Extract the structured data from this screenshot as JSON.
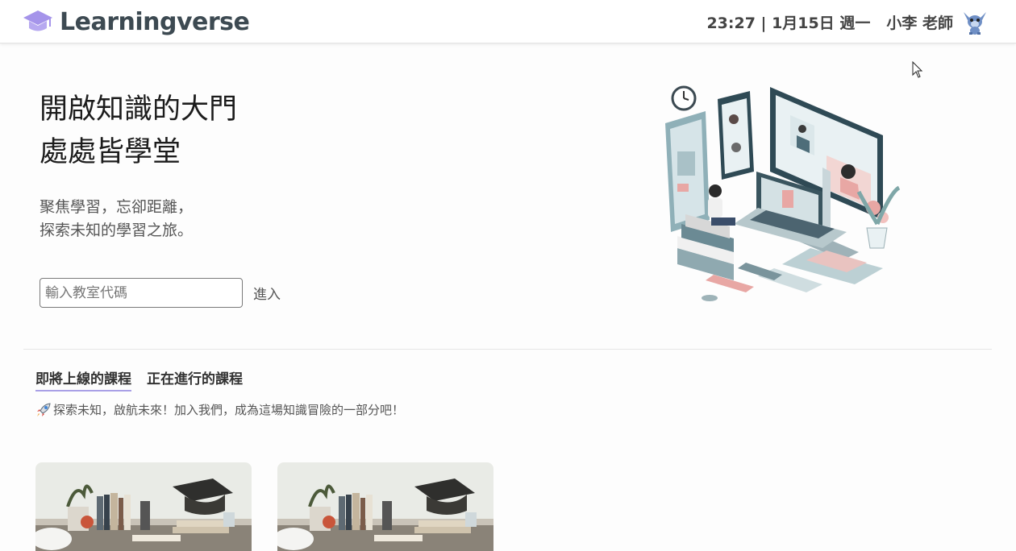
{
  "app": {
    "name": "Learningverse"
  },
  "header": {
    "clock": "23:27 | 1月15日 週一",
    "user": "小李 老師"
  },
  "hero": {
    "title_line1": "開啟知識的大門",
    "title_line2": "處處皆學堂",
    "subtitle_line1": "聚焦學習，忘卻距離，",
    "subtitle_line2": "探索未知的學習之旅。",
    "code_input": {
      "placeholder": "輸入教室代碼",
      "value": ""
    },
    "enter_label": "進入"
  },
  "courses": {
    "tabs": [
      {
        "label": "即將上線的課程",
        "active": true
      },
      {
        "label": "正在進行的課程",
        "active": false
      }
    ],
    "tagline": "探索未知，啟航未來！加入我們，成為這場知識冒險的一部分吧！"
  },
  "colors": {
    "brand_purple": "#9d8ee6",
    "tab_underline": "#a9a0e6",
    "brand_text": "#3d4a52"
  }
}
